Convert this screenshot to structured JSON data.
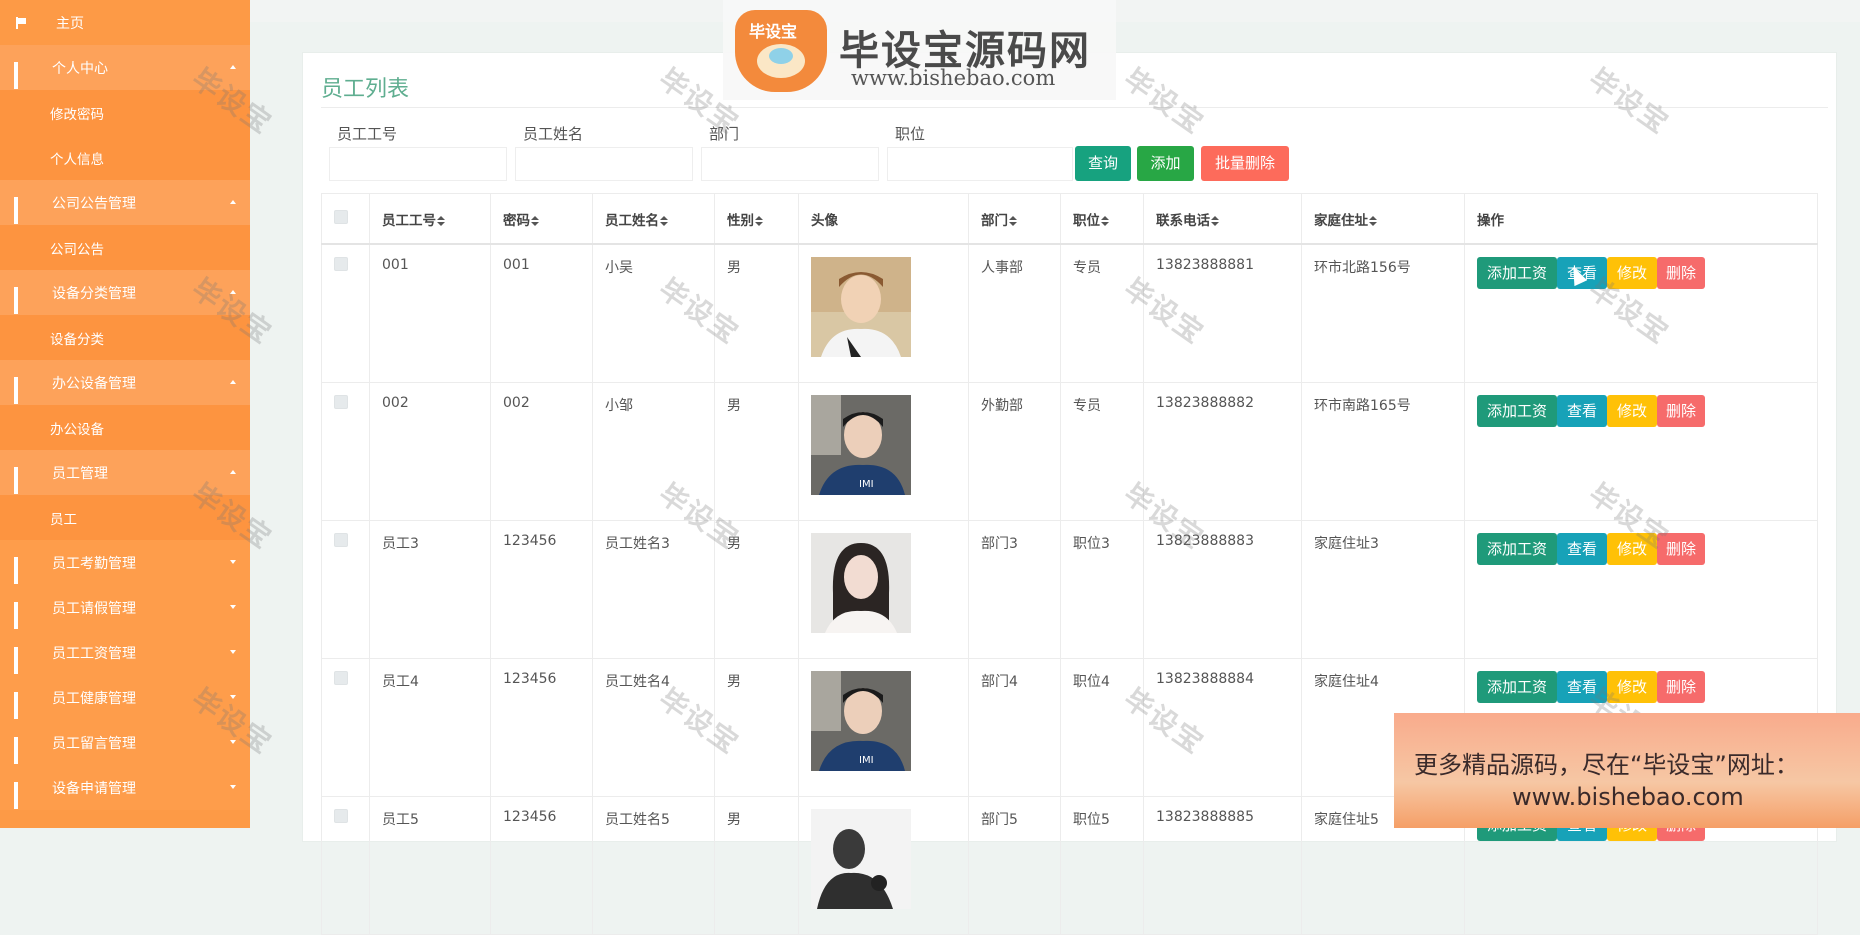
{
  "sidebar": {
    "home": "主页",
    "groups": [
      {
        "label": "个人中心",
        "open": true,
        "subs": [
          "修改密码",
          "个人信息"
        ]
      },
      {
        "label": "公司公告管理",
        "open": true,
        "subs": [
          "公司公告"
        ]
      },
      {
        "label": "设备分类管理",
        "open": true,
        "subs": [
          "设备分类"
        ]
      },
      {
        "label": "办公设备管理",
        "open": true,
        "subs": [
          "办公设备"
        ]
      },
      {
        "label": "员工管理",
        "open": true,
        "subs": [
          "员工"
        ]
      },
      {
        "label": "员工考勤管理",
        "open": false,
        "subs": []
      },
      {
        "label": "员工请假管理",
        "open": false,
        "subs": []
      },
      {
        "label": "员工工资管理",
        "open": false,
        "subs": []
      },
      {
        "label": "员工健康管理",
        "open": false,
        "subs": []
      },
      {
        "label": "员工留言管理",
        "open": false,
        "subs": []
      },
      {
        "label": "设备申请管理",
        "open": false,
        "subs": []
      }
    ]
  },
  "page": {
    "title": "员工列表",
    "filters": [
      {
        "label": "员工工号",
        "value": "",
        "placeholder": ""
      },
      {
        "label": "员工姓名",
        "value": "",
        "placeholder": ""
      },
      {
        "label": "部门",
        "value": "",
        "placeholder": ""
      },
      {
        "label": "职位",
        "value": "",
        "placeholder": ""
      }
    ],
    "buttons": {
      "search": "查询",
      "add": "添加",
      "batch_delete": "批量删除"
    }
  },
  "table": {
    "columns": [
      "员工工号",
      "密码",
      "员工姓名",
      "性别",
      "头像",
      "部门",
      "职位",
      "联系电话",
      "家庭住址",
      "操作"
    ],
    "actions": {
      "add_salary": "添加工资",
      "view": "查看",
      "edit": "修改",
      "delete": "删除"
    },
    "rows": [
      {
        "id": "001",
        "password": "001",
        "name": "小吴",
        "gender": "男",
        "dept": "人事部",
        "position": "专员",
        "phone": "13823888881",
        "address": "环市北路156号",
        "avatar": "avatar-boy-white"
      },
      {
        "id": "002",
        "password": "002",
        "name": "小邹",
        "gender": "男",
        "dept": "外勤部",
        "position": "专员",
        "phone": "13823888882",
        "address": "环市南路165号",
        "avatar": "avatar-boy-car"
      },
      {
        "id": "员工3",
        "password": "123456",
        "name": "员工姓名3",
        "gender": "男",
        "dept": "部门3",
        "position": "职位3",
        "phone": "13823888883",
        "address": "家庭住址3",
        "avatar": "avatar-girl"
      },
      {
        "id": "员工4",
        "password": "123456",
        "name": "员工姓名4",
        "gender": "男",
        "dept": "部门4",
        "position": "职位4",
        "phone": "13823888884",
        "address": "家庭住址4",
        "avatar": "avatar-boy-car"
      },
      {
        "id": "员工5",
        "password": "123456",
        "name": "员工姓名5",
        "gender": "男",
        "dept": "部门5",
        "position": "职位5",
        "phone": "13823888885",
        "address": "家庭住址5",
        "avatar": "avatar-silhouette"
      }
    ]
  },
  "overlay": {
    "logo_cn": "毕设宝源码网",
    "logo_en": "www.bishebao.com",
    "logo_badge": "毕设宝",
    "watermark": "毕设宝",
    "promo_line1": "更多精品源码，尽在“毕设宝”网址：",
    "promo_line2": "www.bishebao.com"
  },
  "colors": {
    "sidebar_bg": "#fd9a46",
    "title": "#5fae90",
    "btn_search": "#17a27f",
    "btn_add": "#28a745",
    "btn_delete": "#fd6b5b",
    "op_salary": "#1f9a7a",
    "op_view": "#17a2b8",
    "op_edit": "#ffc107",
    "op_delete": "#f66b6b"
  }
}
